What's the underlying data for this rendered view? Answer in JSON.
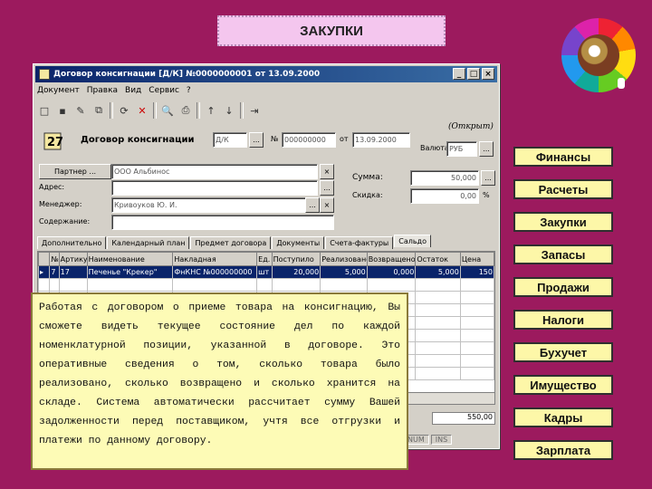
{
  "slide_title": "ЗАКУПКИ",
  "right_menu": {
    "items": [
      "Финансы",
      "Расчеты",
      "Закупки",
      "Запасы",
      "Продажи",
      "Налоги",
      "Бухучет",
      "Имущество",
      "Кадры",
      "Зарплата"
    ]
  },
  "window": {
    "title": "Договор консигнации [Д/К] №0000000001 от 13.09.2000",
    "minimize": "_",
    "maximize": "□",
    "close": "×",
    "menu": [
      "Документ",
      "Правка",
      "Вид",
      "Сервис",
      "?"
    ],
    "doc_title": "Договор консигнации",
    "status": "(Открыт)",
    "type_code": "Д/К",
    "number_label": "№",
    "number": "000000000",
    "from_label": "от",
    "date": "13.09.2000",
    "currency_label": "Валюта",
    "currency": "РУБ",
    "ellipsis": "...",
    "partner_label": "Партнер ...",
    "partner_value": "ООО Альбинос",
    "address_label": "Адрес:",
    "manager_label": "Менеджер:",
    "manager_value": "Кривоуков Ю. И.",
    "content_label": "Содержание:",
    "sum_label": "Сумма:",
    "sum_value": "50,000",
    "discount_label": "Скидка:",
    "discount_value": "0,00",
    "percent": "%",
    "tabs": [
      "Дополнительно",
      "Календарный план",
      "Предмет договора",
      "Документы",
      "Счета-фактуры",
      "Сальдо"
    ],
    "grid": {
      "headers": [
        "",
        "№",
        "Артикул",
        "Наименование",
        "Накладная",
        "Ед.",
        "Поступило",
        "Реализовано",
        "Возвращено",
        "Остаток",
        "Цена"
      ],
      "rows": [
        [
          "",
          "7",
          "17",
          "Печенье \"Крекер\"",
          "ФнКНС №000000000",
          "шт",
          "20,000",
          "5,000",
          "0,000",
          "5,000",
          "150"
        ]
      ]
    },
    "total": "550,00",
    "status_num": "NUM",
    "status_ins": "INS"
  },
  "note": {
    "text": "Работая с договором о приеме товара на консигнацию, Вы сможете видеть текущее состояние дел по каждой номенклатурной позиции, указанной в договоре. Это оперативные сведения о том, сколько товара было реализовано, сколько возвращено и сколько хранится на складе. Система автоматически рассчитает сумму Вашей задолженности перед поставщиком, учтя все отгрузки и платежи по данному договору."
  }
}
